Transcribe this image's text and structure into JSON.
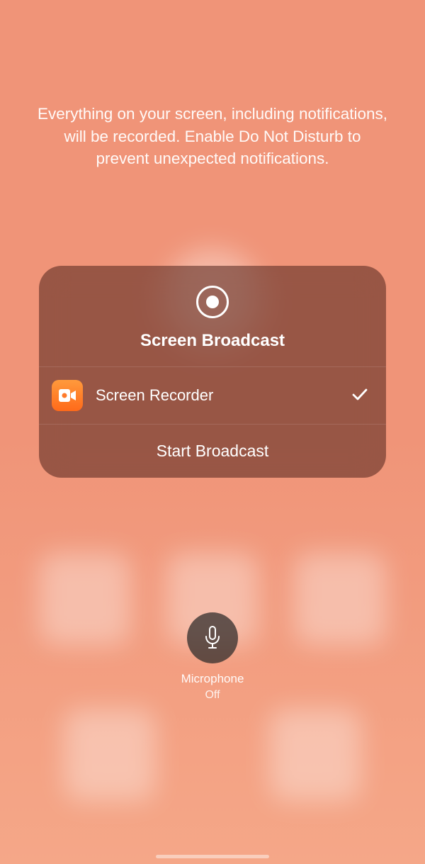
{
  "disclaimer": "Everything on your screen, including notifications, will be recorded. Enable Do Not Disturb to prevent unexpected notifications.",
  "card": {
    "title": "Screen Broadcast",
    "app": {
      "name": "Screen Recorder",
      "selected": true
    },
    "start_label": "Start Broadcast"
  },
  "microphone": {
    "label": "Microphone",
    "status": "Off"
  },
  "icons": {
    "record": "record-icon",
    "video": "videocam-icon",
    "check": "checkmark-icon",
    "mic": "microphone-icon"
  }
}
